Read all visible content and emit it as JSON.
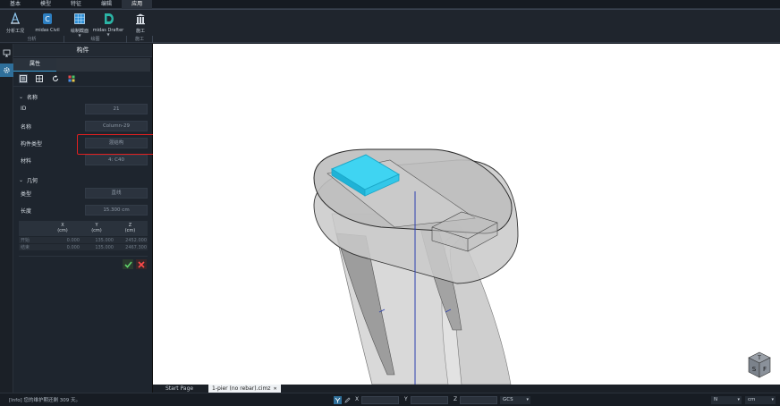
{
  "menu": {
    "items": [
      "基本",
      "模型",
      "特征",
      "编辑",
      "应用"
    ],
    "active_index": 4
  },
  "ribbon": {
    "buttons": [
      {
        "label": "分析工况",
        "icon": "analysis-icon"
      },
      {
        "label": "midas Civil",
        "icon": "midas-civil-icon"
      },
      {
        "label": "绘制截面",
        "icon": "grid-icon"
      },
      {
        "label": "midas Drafter",
        "icon": "drafter-icon"
      },
      {
        "label": "施工",
        "icon": "construction-icon"
      }
    ],
    "groups": [
      "分析",
      "绘图",
      "施工"
    ]
  },
  "panel": {
    "title": "构件",
    "tab": "属性",
    "sections": {
      "name": "名称",
      "geometry": "几何"
    },
    "fields": {
      "id": {
        "label": "ID",
        "value": "21"
      },
      "name": {
        "label": "名称",
        "value": "Column-29"
      },
      "member_type": {
        "label": "构件类型",
        "value": "混结构"
      },
      "material": {
        "label": "材料",
        "value": "4: C40"
      },
      "geo_type": {
        "label": "类型",
        "value": "直线"
      },
      "length": {
        "label": "长度",
        "value": "15.300 cm"
      }
    },
    "coords": {
      "headers": [
        "",
        "X\n(cm)",
        "Y\n(cm)",
        "Z\n(cm)"
      ],
      "rows": [
        [
          "开始",
          "0.000",
          "135.000",
          "2452.000"
        ],
        [
          "结束",
          "0.000",
          "135.000",
          "2467.300"
        ]
      ]
    }
  },
  "doc_tabs": [
    {
      "label": "Start Page",
      "active": false
    },
    {
      "label": "1-pier (no rebar).cimz",
      "active": true
    }
  ],
  "status": {
    "message": "[Info] 您的维护期还剩 309 天。",
    "x_label": "X",
    "y_label": "Y",
    "z_label": "Z",
    "coord_system": "GCS",
    "force_unit": "N",
    "length_unit": "cm"
  },
  "viewcube": {
    "letters": [
      "T",
      "S",
      "F"
    ]
  },
  "colors": {
    "accent": "#3aa0d8",
    "highlight": "#e02020",
    "selected_face": "#3fd4f2"
  }
}
